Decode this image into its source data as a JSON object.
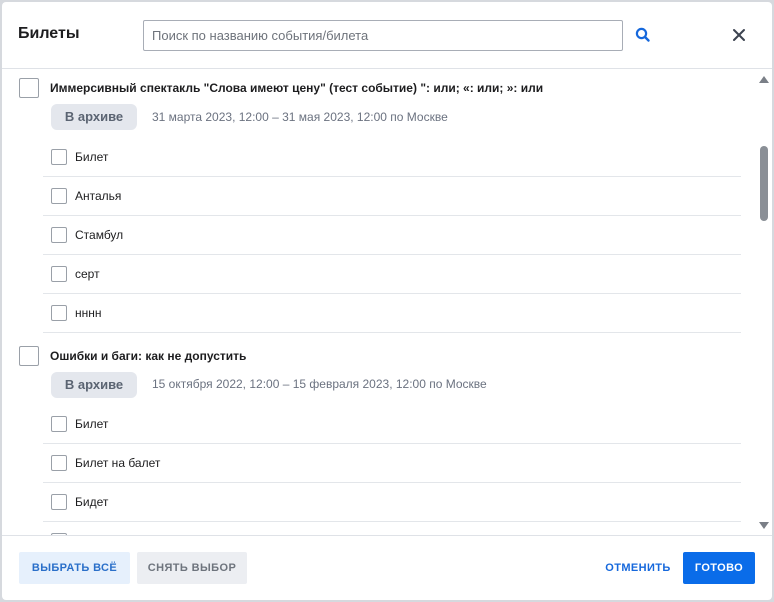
{
  "header": {
    "title": "Билеты",
    "search_placeholder": "Поиск по названию события/билета",
    "search_value": ""
  },
  "events": [
    {
      "title": "Иммерсивный спектакль \"Слова имеют цену\" (тест событие) \": или; «: или; »: или",
      "badge": "В архиве",
      "date": "31 марта 2023, 12:00 – 31 мая 2023, 12:00 по Москве",
      "tickets": [
        "Билет",
        "Анталья",
        "Стамбул",
        "серт",
        "нннн"
      ]
    },
    {
      "title": "Ошибки и баги: как не допустить",
      "badge": "В архиве",
      "date": "15 октября 2022, 12:00 – 15 февраля 2023, 12:00 по Москве",
      "tickets": [
        "Билет",
        "Билет на балет",
        "Бидет"
      ]
    }
  ],
  "footer": {
    "select_all_label": "ВЫБРАТЬ ВСЁ",
    "deselect_label": "СНЯТЬ ВЫБОР",
    "cancel_label": "ОТМЕНИТЬ",
    "done_label": "ГОТОВО"
  },
  "icons": {
    "search": "search-icon",
    "close": "close-icon"
  },
  "colors": {
    "primary": "#0a6ce9",
    "badge_bg": "#e4e7ed",
    "select_all_bg": "#e6f0fc"
  }
}
